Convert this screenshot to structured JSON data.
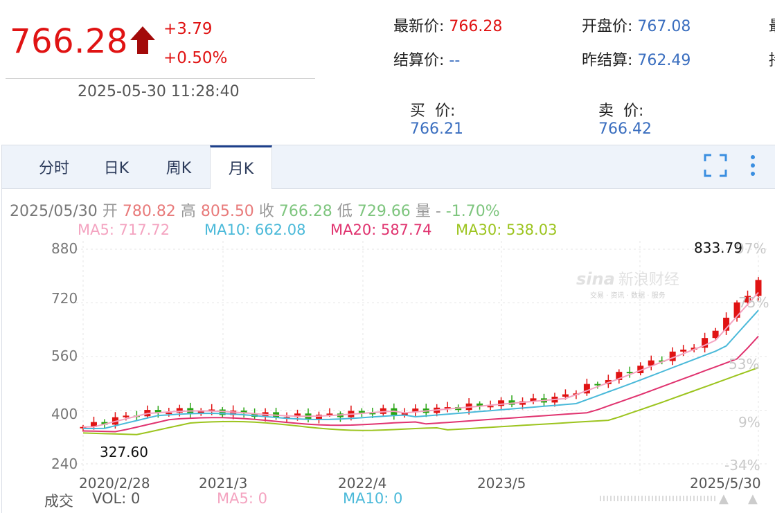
{
  "header": {
    "price": "766.28",
    "change": "+3.79",
    "change_pct": "+0.50%",
    "timestamp": "2025-05-30 11:28:40",
    "quotes": {
      "latest_label": "最新价:",
      "latest_value": "766.28",
      "open_label": "开盘价:",
      "open_value": "767.08",
      "settle_label": "结算价:",
      "settle_value": "--",
      "prev_settle_label": "昨结算:",
      "prev_settle_value": "762.49",
      "bid_label": "买  价:",
      "bid_value": "766.21",
      "ask_label": "卖  价:",
      "ask_value": "766.42",
      "cut_1": "最",
      "cut_2": "持"
    }
  },
  "tabs": [
    {
      "label": "分时",
      "active": false
    },
    {
      "label": "日K",
      "active": false
    },
    {
      "label": "周K",
      "active": false
    },
    {
      "label": "月K",
      "active": true
    }
  ],
  "info": {
    "date": "2025/05/30",
    "open_label": "开",
    "open": "780.82",
    "high_label": "高",
    "high": "805.50",
    "close_label": "收",
    "close": "766.28",
    "low_label": "低",
    "low": "729.66",
    "vol_label": "量",
    "vol": "-",
    "change": "-1.70%"
  },
  "ma": {
    "ma5": "MA5: 717.72",
    "ma10": "MA10: 662.08",
    "ma20": "MA20: 587.74",
    "ma30": "MA30: 538.03"
  },
  "chart": {
    "y_ticks": [
      "880",
      "720",
      "560",
      "400",
      "240"
    ],
    "pct_ticks": [
      "97%",
      "75%",
      "53%",
      "9%",
      "-34%"
    ],
    "x_ticks": [
      "2020/2/28",
      "2021/3",
      "2022/4",
      "2023/5",
      "2025/5/30"
    ],
    "max_label": "833.79",
    "min_label": "327.60",
    "watermark": "新浪财经",
    "watermark_logo": "sina",
    "watermark_sub": "交易 · 资讯 · 数据 · 服务",
    "colors": {
      "up": "#e01313",
      "down": "#2aa515",
      "ma5": "#f4a3c0",
      "ma10": "#4ab9d9",
      "ma20": "#e0336f",
      "ma30": "#9cc41e"
    }
  },
  "volume": {
    "label": "成交",
    "vol": "VOL: 0",
    "ma5": "MA5: 0",
    "ma10": "MA10: 0"
  }
}
